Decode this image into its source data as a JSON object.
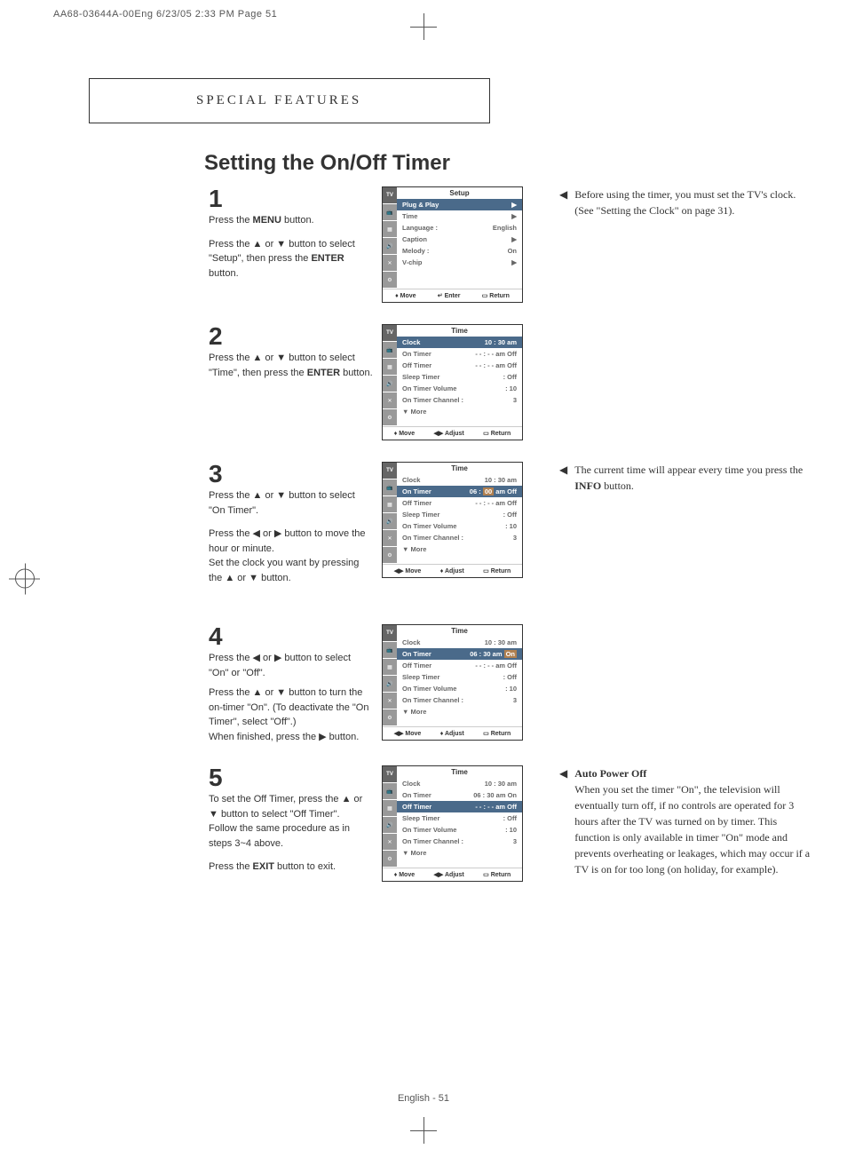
{
  "printHeader": "AA68-03644A-00Eng  6/23/05  2:33 PM  Page 51",
  "sectionHeader": "SPECIAL FEATURES",
  "title": "Setting the On/Off Timer",
  "pageNum": "English - 51",
  "steps": {
    "s1": {
      "num": "1",
      "line1": "Press the ",
      "b1": "MENU",
      "line2": " button.",
      "line3": "Press the ▲ or ▼ button to select \"Setup\", then press the ",
      "b2": "ENTER",
      "line4": " button."
    },
    "s2": {
      "num": "2",
      "line1": "Press the ▲ or ▼ button to select \"Time\", then press the ",
      "b1": "ENTER",
      "line2": " button."
    },
    "s3": {
      "num": "3",
      "line1": "Press the ▲ or ▼ button to select \"On Timer\".",
      "line2": "Press the ◀ or ▶ button to move the hour or minute.",
      "line3": "Set the clock you want by pressing the ▲ or ▼ button."
    },
    "s4": {
      "num": "4",
      "line1": "Press the ◀ or ▶ button to select \"On\" or \"Off\".",
      "line2": "Press the ▲ or ▼ button to turn the on-timer \"On\". (To deactivate the \"On Timer\", select \"Off\".)",
      "line3": "When finished, press the ▶ button."
    },
    "s5": {
      "num": "5",
      "line1": "To set the Off Timer, press the ▲ or ▼ button to select \"Off Timer\".",
      "line2": "Follow the same procedure as in steps 3~4 above.",
      "line3": "Press the ",
      "b1": "EXIT",
      "line4": " button to exit."
    }
  },
  "osd1": {
    "title": "Setup",
    "rows": [
      {
        "l": "Plug & Play",
        "r": "▶",
        "sel": true
      },
      {
        "l": "Time",
        "r": "▶"
      },
      {
        "l": "Language :",
        "r": "English"
      },
      {
        "l": "Caption",
        "r": "▶"
      },
      {
        "l": "Melody    :",
        "r": "On"
      },
      {
        "l": "V-chip",
        "r": "▶"
      }
    ],
    "footer": [
      "♦ Move",
      "↵ Enter",
      "▭ Return"
    ]
  },
  "osd2": {
    "title": "Time",
    "rows": [
      {
        "l": "Clock",
        "r": "10 : 30 am",
        "sel": true
      },
      {
        "l": "On Timer",
        "r": "- - : - - am Off"
      },
      {
        "l": "Off Timer",
        "r": "- - : - - am Off"
      },
      {
        "l": "Sleep Timer",
        "r": ": Off"
      },
      {
        "l": "On Timer Volume",
        "r": ": 10"
      },
      {
        "l": "On Timer Channel :",
        "r": "3"
      },
      {
        "l": "▼ More",
        "r": ""
      }
    ],
    "footer": [
      "♦ Move",
      "◀▶ Adjust",
      "▭ Return"
    ]
  },
  "osd3": {
    "title": "Time",
    "rows": [
      {
        "l": "Clock",
        "r": "10 : 30 am"
      },
      {
        "l": "On Timer",
        "r": "06 : ",
        "hl": "00",
        "r2": " am Off",
        "sel": true
      },
      {
        "l": "Off Timer",
        "r": "- - : - - am Off"
      },
      {
        "l": "Sleep Timer",
        "r": ": Off"
      },
      {
        "l": "On Timer Volume",
        "r": ": 10"
      },
      {
        "l": "On Timer Channel :",
        "r": "3"
      },
      {
        "l": "▼ More",
        "r": ""
      }
    ],
    "footer": [
      "◀▶ Move",
      "♦ Adjust",
      "▭ Return"
    ]
  },
  "osd4": {
    "title": "Time",
    "rows": [
      {
        "l": "Clock",
        "r": "10 : 30 am"
      },
      {
        "l": "On Timer",
        "r": "06 : 30 am ",
        "hl": "On",
        "sel": true
      },
      {
        "l": "Off Timer",
        "r": "- - : - - am Off"
      },
      {
        "l": "Sleep Timer",
        "r": ": Off"
      },
      {
        "l": "On Timer Volume",
        "r": ": 10"
      },
      {
        "l": "On Timer Channel :",
        "r": "3"
      },
      {
        "l": "▼ More",
        "r": ""
      }
    ],
    "footer": [
      "◀▶ Move",
      "♦ Adjust",
      "▭ Return"
    ]
  },
  "osd5": {
    "title": "Time",
    "rows": [
      {
        "l": "Clock",
        "r": "10 : 30 am"
      },
      {
        "l": "On Timer",
        "r": "06 : 30 am On"
      },
      {
        "l": "Off Timer",
        "r": "- - : - - am Off",
        "sel": true
      },
      {
        "l": "Sleep Timer",
        "r": ": Off"
      },
      {
        "l": "On Timer Volume",
        "r": ": 10"
      },
      {
        "l": "On Timer Channel :",
        "r": "3"
      },
      {
        "l": "▼ More",
        "r": ""
      }
    ],
    "footer": [
      "♦ Move",
      "◀▶ Adjust",
      "▭ Return"
    ]
  },
  "sidebar": {
    "n1": "Before using the timer, you must set the TV's clock. (See \"Setting the Clock\" on page 31).",
    "n2a": "The current time will appear every time you press the ",
    "n2b": "INFO",
    "n2c": " button.",
    "n3t": "Auto Power Off",
    "n3": "When you set the timer \"On\", the television will eventually turn off, if no controls are operated for 3 hours after the TV was turned on by timer. This function is only available in timer \"On\" mode and prevents overheating or leakages, which may occur if a TV is on for too long (on holiday, for example)."
  },
  "tvLabel": "TV"
}
